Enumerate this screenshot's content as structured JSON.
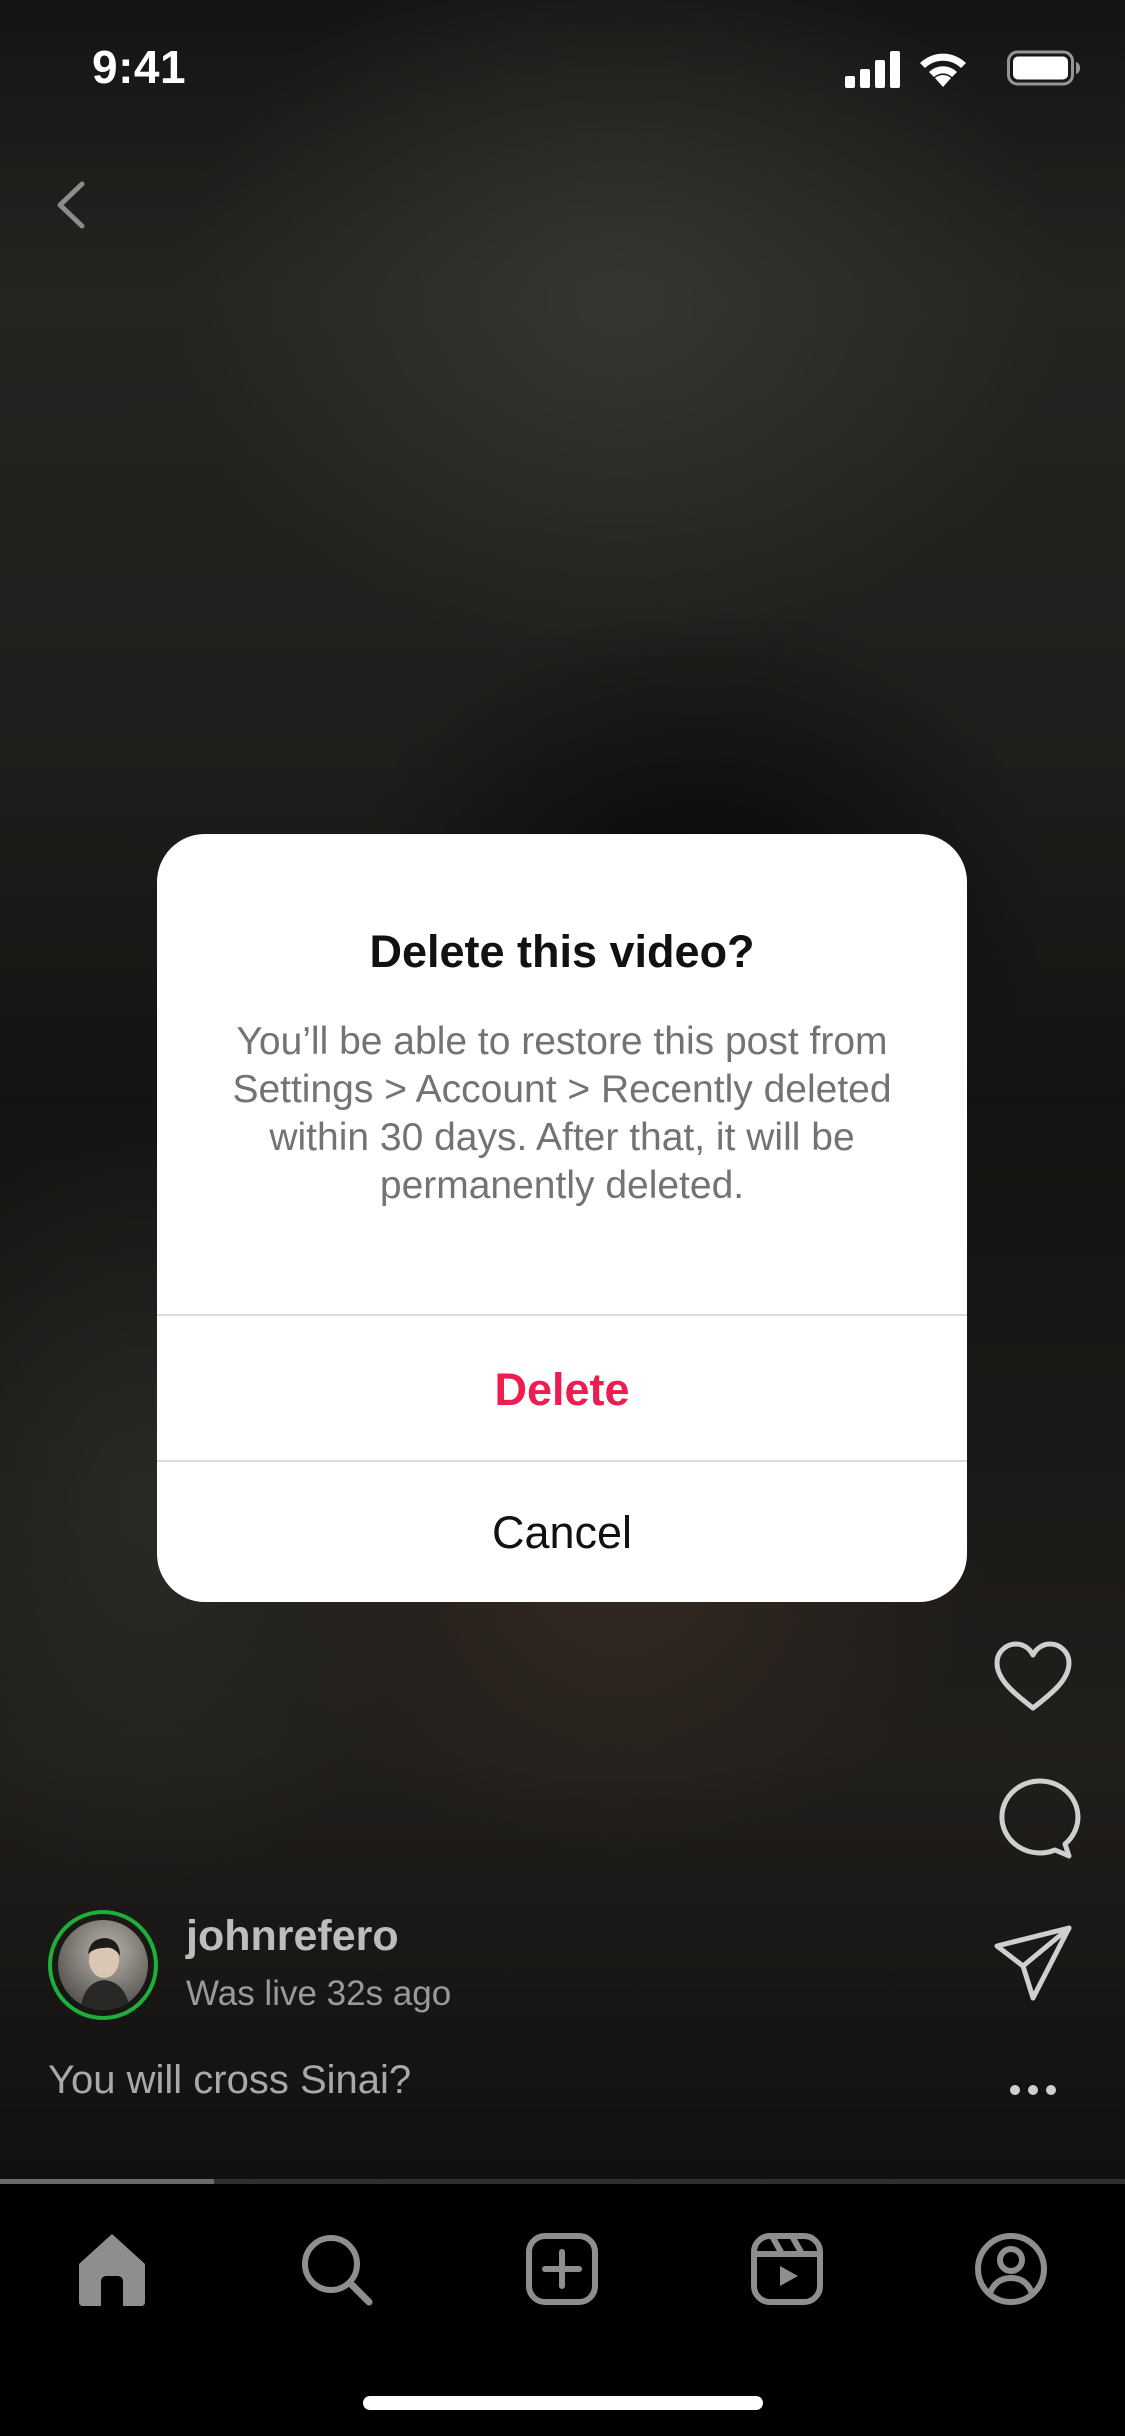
{
  "status_bar": {
    "time": "9:41",
    "icons": [
      "cellular-signal-icon",
      "wifi-icon",
      "battery-icon"
    ]
  },
  "nav": {
    "back_icon": "chevron-left-icon"
  },
  "dialog": {
    "title": "Delete this video?",
    "message": "You’ll be able to restore this post from Settings > Account > Recently deleted within 30 days. After that, it will be permanently deleted.",
    "delete_label": "Delete",
    "cancel_label": "Cancel",
    "delete_color": "#ED1D4F"
  },
  "post": {
    "username": "johnrefero",
    "live_status": "Was live 32s ago",
    "caption": "You will cross Sinai?",
    "avatar_ring_color": "#1FAE3A",
    "progress_fraction": 0.19
  },
  "side_actions": [
    "heart-icon",
    "comment-icon",
    "share-icon"
  ],
  "tab_bar": {
    "tabs": [
      "home-icon",
      "search-icon",
      "create-icon",
      "reels-icon",
      "profile-icon"
    ],
    "active": "home-icon"
  }
}
